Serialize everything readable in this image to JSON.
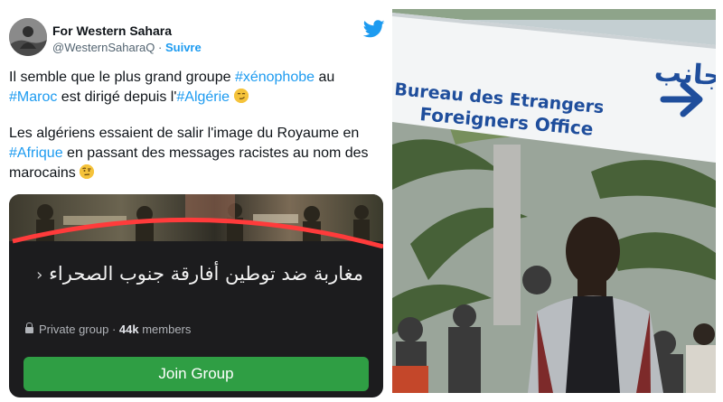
{
  "tweet": {
    "display_name": "For Western Sahara",
    "handle": "@WesternSaharaQ",
    "separator": " · ",
    "follow_label": "Suivre",
    "paragraph1": {
      "t1": "Il semble que le plus grand groupe ",
      "tag1": "#xénophobe",
      "t2": " au ",
      "tag2": "#Maroc",
      "t3": " est dirigé depuis l'",
      "tag3": "#Algérie"
    },
    "paragraph2": {
      "t1": "Les algériens essaient de salir l'image du Royaume en ",
      "tag1": "#Afrique",
      "t2": " en passant des messages racistes au nom des marocains"
    },
    "emoji1": "smirking-face",
    "emoji2": "face-with-raised-eyebrow"
  },
  "group_card": {
    "name": "مغاربة ضد توطين أفارقة جنوب الصحراء",
    "chevron": "‹",
    "privacy": "Private group",
    "separator": " · ",
    "members": "44k",
    "members_suffix": " members",
    "join_label": "Join Group"
  },
  "photo": {
    "sign_arabic": "مكتب الأجانب",
    "sign_line1": "Bureau des Etrangers",
    "sign_line2": "Foreigners Office",
    "arrow": "arrow-right-icon"
  },
  "colors": {
    "link": "#1d9bf0",
    "join": "#2f9e44",
    "sign_text": "#1f4e9c"
  }
}
